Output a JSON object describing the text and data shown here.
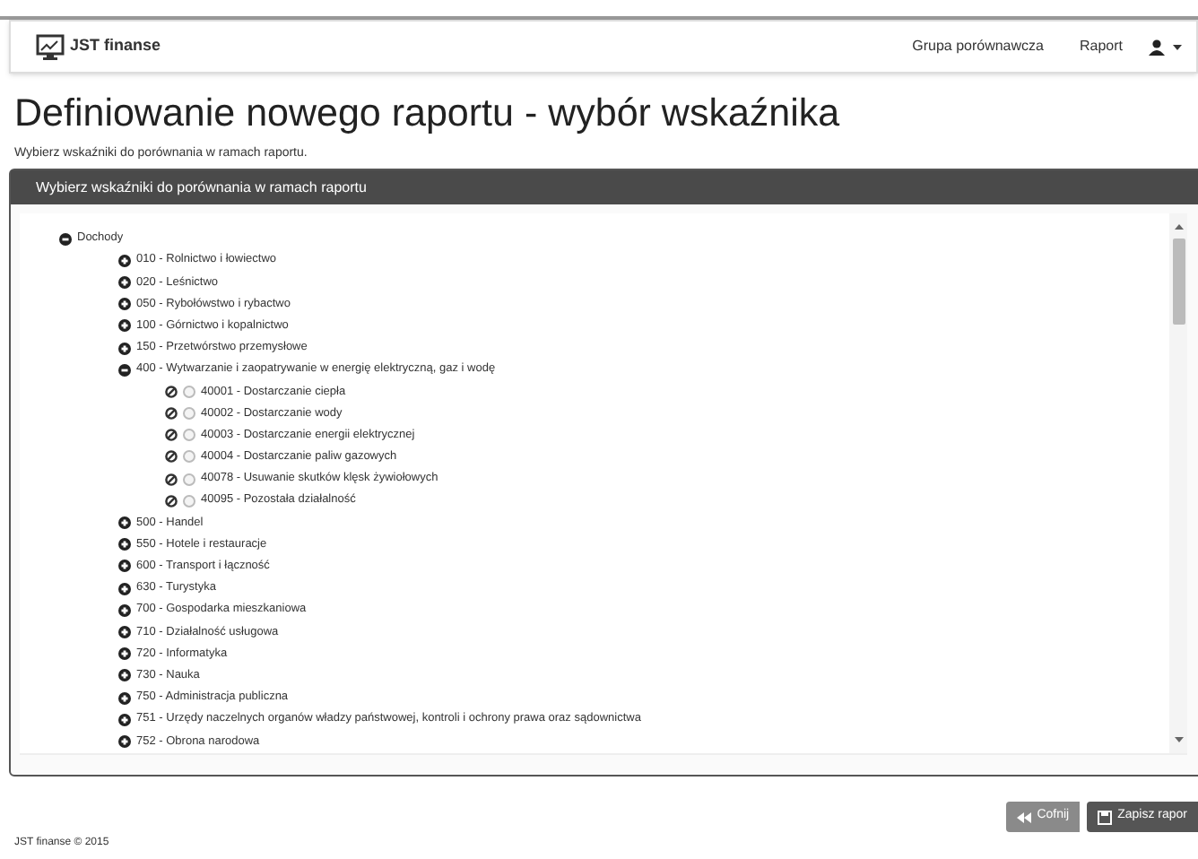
{
  "navbar": {
    "brand": "JST finanse",
    "links": [
      {
        "label": "Grupa porównawcza"
      },
      {
        "label": "Raport"
      }
    ]
  },
  "page": {
    "title": "Definiowanie nowego raportu - wybór wskaźnika",
    "subtitle": "Wybierz wskaźniki do porównania w ramach raportu."
  },
  "panel": {
    "heading": "Wybierz wskaźniki do porównania w ramach raportu",
    "tree": [
      {
        "label": "Dochody",
        "expanded": true,
        "children": [
          {
            "label": "010 - Rolnictwo i łowiectwo",
            "expanded": false
          },
          {
            "label": "020 - Leśnictwo",
            "expanded": false
          },
          {
            "label": "050 - Rybołówstwo i rybactwo",
            "expanded": false
          },
          {
            "label": "100 - Górnictwo i kopalnictwo",
            "expanded": false
          },
          {
            "label": "150 - Przetwórstwo przemysłowe",
            "expanded": false
          },
          {
            "label": "400 - Wytwarzanie i zaopatrywanie w energię elektryczną, gaz i wodę",
            "expanded": true,
            "children": [
              {
                "label": "40001 - Dostarczanie ciepła",
                "selected": false
              },
              {
                "label": "40002 - Dostarczanie wody",
                "selected": false
              },
              {
                "label": "40003 - Dostarczanie energii elektrycznej",
                "selected": false
              },
              {
                "label": "40004 - Dostarczanie paliw gazowych",
                "selected": false
              },
              {
                "label": "40078 - Usuwanie skutków klęsk żywiołowych",
                "selected": false
              },
              {
                "label": "40095 - Pozostała działalność",
                "selected": false
              }
            ]
          },
          {
            "label": "500 - Handel",
            "expanded": false
          },
          {
            "label": "550 - Hotele i restauracje",
            "expanded": false
          },
          {
            "label": "600 - Transport i łączność",
            "expanded": false
          },
          {
            "label": "630 - Turystyka",
            "expanded": false
          },
          {
            "label": "700 - Gospodarka mieszkaniowa",
            "expanded": false
          },
          {
            "label": "710 - Działalność usługowa",
            "expanded": false
          },
          {
            "label": "720 - Informatyka",
            "expanded": false
          },
          {
            "label": "730 - Nauka",
            "expanded": false
          },
          {
            "label": "750 - Administracja publiczna",
            "expanded": false
          },
          {
            "label": "751 - Urzędy naczelnych organów władzy państwowej, kontroli i ochrony prawa oraz sądownictwa",
            "expanded": false
          },
          {
            "label": "752 - Obrona narodowa",
            "expanded": false
          }
        ]
      }
    ]
  },
  "buttons": [
    {
      "label": "Cofnij"
    },
    {
      "label": "Zapisz rapor"
    }
  ],
  "footer": "JST finanse © 2015"
}
